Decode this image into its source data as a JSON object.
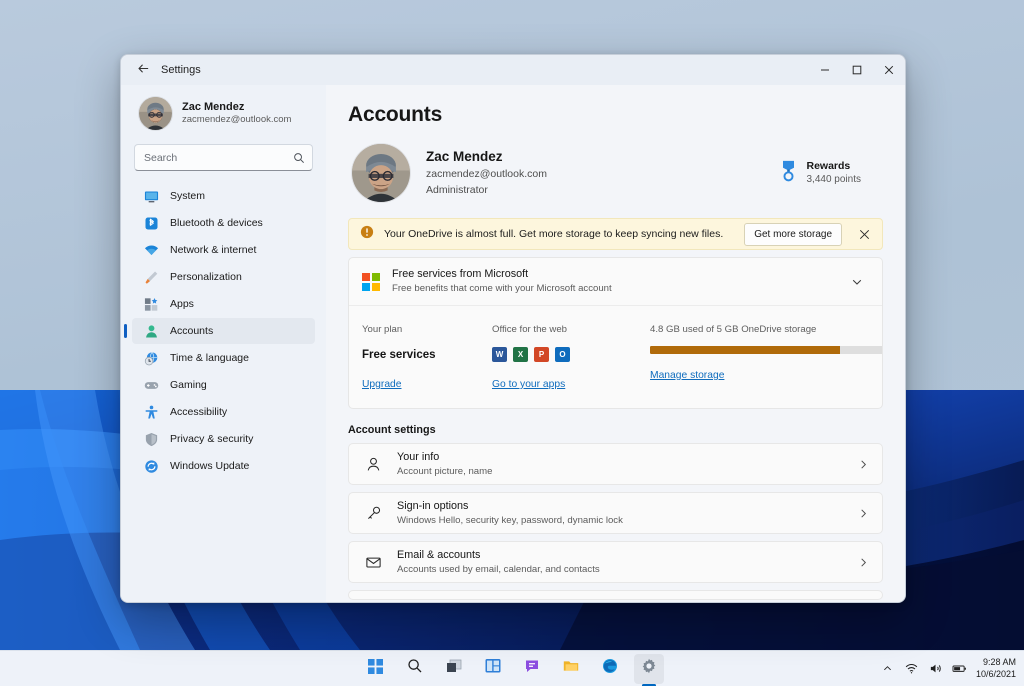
{
  "window": {
    "title": "Settings",
    "back_icon": "back-arrow-icon",
    "controls": {
      "minimize": "minimize-icon",
      "maximize": "maximize-icon",
      "close": "close-icon"
    }
  },
  "sidebar": {
    "profile": {
      "name": "Zac Mendez",
      "email": "zacmendez@outlook.com"
    },
    "search": {
      "placeholder": "Search",
      "value": "",
      "icon": "search-icon"
    },
    "items": [
      {
        "label": "System",
        "icon": "monitor-icon",
        "selected": false
      },
      {
        "label": "Bluetooth & devices",
        "icon": "bluetooth-icon",
        "selected": false
      },
      {
        "label": "Network & internet",
        "icon": "wifi-icon",
        "selected": false
      },
      {
        "label": "Personalization",
        "icon": "paintbrush-icon",
        "selected": false
      },
      {
        "label": "Apps",
        "icon": "apps-icon",
        "selected": false
      },
      {
        "label": "Accounts",
        "icon": "person-icon",
        "selected": true
      },
      {
        "label": "Time & language",
        "icon": "clock-globe-icon",
        "selected": false
      },
      {
        "label": "Gaming",
        "icon": "gamepad-icon",
        "selected": false
      },
      {
        "label": "Accessibility",
        "icon": "accessibility-icon",
        "selected": false
      },
      {
        "label": "Privacy & security",
        "icon": "shield-icon",
        "selected": false
      },
      {
        "label": "Windows Update",
        "icon": "update-icon",
        "selected": false
      }
    ]
  },
  "main": {
    "page_title": "Accounts",
    "account": {
      "name": "Zac Mendez",
      "email": "zacmendez@outlook.com",
      "role": "Administrator"
    },
    "rewards": {
      "label": "Rewards",
      "points": "3,440 points",
      "icon": "medal-icon"
    },
    "warning": {
      "icon": "warning-icon",
      "text": "Your OneDrive is almost full. Get more storage to keep syncing new files.",
      "cta": "Get more storage",
      "close_icon": "close-icon"
    },
    "services_card": {
      "logo": "microsoft-logo-icon",
      "title": "Free services from Microsoft",
      "subtitle": "Free benefits that come with your Microsoft account",
      "chevron_icon": "chevron-down-icon",
      "plan": {
        "label": "Your plan",
        "value": "Free services",
        "link": "Upgrade"
      },
      "office": {
        "label": "Office for the web",
        "link": "Go to your apps",
        "apps": [
          {
            "name": "Word",
            "glyph": "W",
            "color": "#2b579a"
          },
          {
            "name": "Excel",
            "glyph": "X",
            "color": "#217346"
          },
          {
            "name": "PowerPoint",
            "glyph": "P",
            "color": "#d24726"
          },
          {
            "name": "Outlook",
            "glyph": "O",
            "color": "#0f6cbd"
          }
        ]
      },
      "storage": {
        "label": "4.8 GB used of 5 GB OneDrive storage",
        "used_gb": 4.8,
        "total_gb": 5,
        "percent": 80,
        "fill_color": "#b06a0a",
        "link": "Manage storage"
      }
    },
    "settings_section": {
      "title": "Account settings",
      "rows": [
        {
          "title": "Your info",
          "subtitle": "Account picture, name",
          "icon": "person-outline-icon",
          "chevron": "chevron-right-icon"
        },
        {
          "title": "Sign-in options",
          "subtitle": "Windows Hello, security key, password, dynamic lock",
          "icon": "key-icon",
          "chevron": "chevron-right-icon"
        },
        {
          "title": "Email & accounts",
          "subtitle": "Accounts used by email, calendar, and contacts",
          "icon": "envelope-icon",
          "chevron": "chevron-right-icon"
        }
      ]
    }
  },
  "taskbar": {
    "items": [
      {
        "name": "start-button",
        "icon": "windows-logo-icon"
      },
      {
        "name": "search-button",
        "icon": "search-icon"
      },
      {
        "name": "task-view-button",
        "icon": "task-view-icon"
      },
      {
        "name": "widgets-button",
        "icon": "widgets-icon"
      },
      {
        "name": "chat-button",
        "icon": "chat-icon"
      },
      {
        "name": "file-explorer-button",
        "icon": "folder-icon"
      },
      {
        "name": "edge-button",
        "icon": "edge-icon"
      },
      {
        "name": "settings-button",
        "icon": "gear-icon"
      }
    ],
    "tray": {
      "chevron": "chevron-up-icon",
      "wifi": "wifi-icon",
      "volume": "volume-icon",
      "battery": "battery-icon",
      "time": "9:28 AM",
      "date": "10/6/2021"
    }
  }
}
